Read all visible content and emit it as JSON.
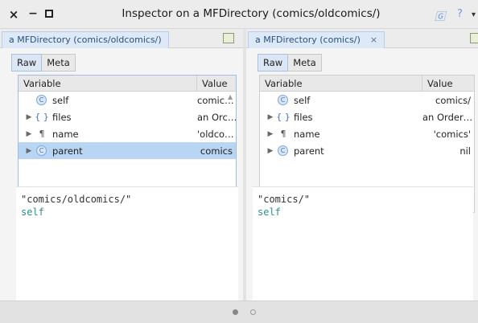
{
  "window": {
    "title": "Inspector on a MFDirectory (comics/oldcomics/)",
    "close": "×",
    "minimize": "−"
  },
  "toolbar": {
    "ghost_icon": "🄶",
    "help": "?",
    "menu": "▾"
  },
  "left": {
    "tab_label": "a MFDirectory (comics/oldcomics/)",
    "subtabs": [
      "Raw",
      "Meta"
    ],
    "columns": [
      "Variable",
      "Value"
    ],
    "rows": [
      {
        "icon": "C",
        "name": "self",
        "value": "comic…",
        "expander": ""
      },
      {
        "icon": "{ }",
        "name": "files",
        "value": "an Orc…",
        "expander": "▶"
      },
      {
        "icon": "¶",
        "name": "name",
        "value": "'oldco…",
        "expander": "▶"
      },
      {
        "icon": "C",
        "name": "parent",
        "value": "comics",
        "expander": "▶"
      }
    ],
    "code_line1": "\"comics/oldcomics/\"",
    "code_line2": "self"
  },
  "right": {
    "tab_label": "a MFDirectory (comics/)",
    "tab_close": "×",
    "subtabs": [
      "Raw",
      "Meta"
    ],
    "columns": [
      "Variable",
      "Value"
    ],
    "rows": [
      {
        "icon": "C",
        "name": "self",
        "value": "comics/",
        "expander": ""
      },
      {
        "icon": "{ }",
        "name": "files",
        "value": "an Order…",
        "expander": "▶"
      },
      {
        "icon": "¶",
        "name": "name",
        "value": "'comics'",
        "expander": "▶"
      },
      {
        "icon": "C",
        "name": "parent",
        "value": "nil",
        "expander": "▶"
      }
    ],
    "code_line1": "\"comics/\"",
    "code_line2": "self"
  },
  "colors": {
    "selection": "#b8d6f4",
    "accent": "#3a6fb5",
    "code_keyword": "#2a8f8f"
  }
}
